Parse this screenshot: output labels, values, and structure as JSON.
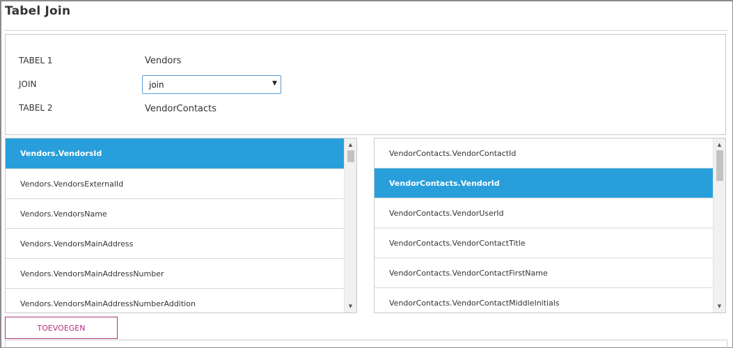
{
  "page": {
    "title": "Tabel Join"
  },
  "config": {
    "table1_label": "TABEL 1",
    "table1_value": "Vendors",
    "join_label": "JOIN",
    "join_selected": "join",
    "table2_label": "TABEL 2",
    "table2_value": "VendorContacts"
  },
  "left_list": {
    "items": [
      {
        "label": "Vendors.VendorsId",
        "selected": true
      },
      {
        "label": "Vendors.VendorsExternalId",
        "selected": false
      },
      {
        "label": "Vendors.VendorsName",
        "selected": false
      },
      {
        "label": "Vendors.VendorsMainAddress",
        "selected": false
      },
      {
        "label": "Vendors.VendorsMainAddressNumber",
        "selected": false
      },
      {
        "label": "Vendors.VendorsMainAddressNumberAddition",
        "selected": false
      }
    ]
  },
  "right_list": {
    "items": [
      {
        "label": "VendorContacts.VendorContactId",
        "selected": false
      },
      {
        "label": "VendorContacts.VendorId",
        "selected": true
      },
      {
        "label": "VendorContacts.VendorUserId",
        "selected": false
      },
      {
        "label": "VendorContacts.VendorContactTitle",
        "selected": false
      },
      {
        "label": "VendorContacts.VendorContactFirstName",
        "selected": false
      },
      {
        "label": "VendorContacts.VendorContactMiddleInitials",
        "selected": false
      }
    ]
  },
  "actions": {
    "add_label": "TOEVOEGEN"
  },
  "colors": {
    "selected_row": "#289fdb",
    "add_button": "#b0307a",
    "select_border": "#5b9bd5"
  },
  "icons": {
    "select_arrow": "caret-down-icon",
    "scroll_up": "scroll-up-icon",
    "scroll_down": "scroll-down-icon"
  }
}
